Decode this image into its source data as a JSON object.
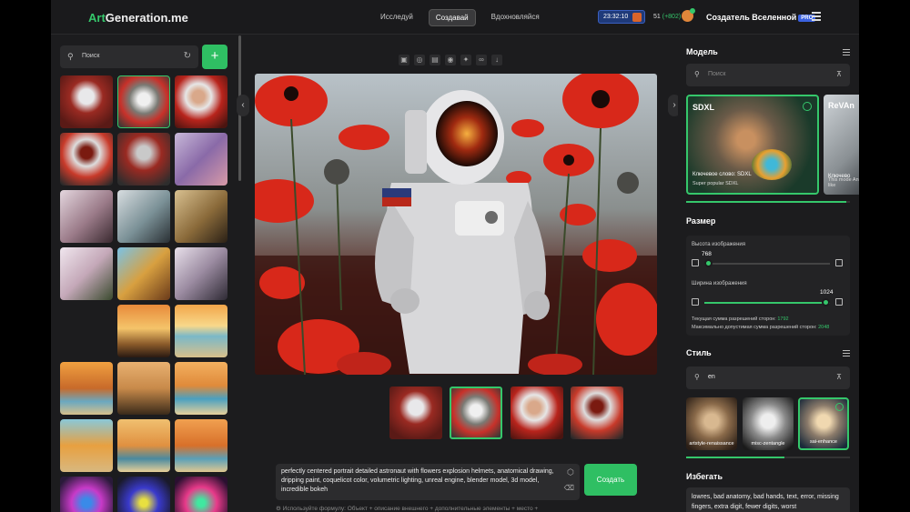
{
  "header": {
    "logo_left": "Art",
    "logo_mid": "Generation",
    "logo_right": ".me",
    "nav": [
      "Исследуй",
      "Создавай",
      "Вдохновляйся"
    ],
    "timer": "23:32:10",
    "credits": "51",
    "credits_bonus": "(+802)",
    "user_name": "Создатель Вселенной",
    "badge": "PRO"
  },
  "left": {
    "search_placeholder": "Поиск",
    "add_label": "+"
  },
  "center": {
    "prompt_text": "perfectly centered portrait detailed astronaut with flowers explosion helmets, anatomical drawing, dripping paint, coquelicot color, volumetric lighting, unreal engine, blender model, 3d model, incredible bokeh",
    "create_label": "Создать",
    "hint": "Используйте формулу: Объект + описание внешнего + дополнительные элементы + место +"
  },
  "right": {
    "model_title": "Модель",
    "model_search_placeholder": "Поиск",
    "models": [
      {
        "name": "SDXL",
        "keyword": "Ключевое слово: SDXL",
        "desc": "Super popular SDXL"
      },
      {
        "name": "ReVAn",
        "keyword": "Ключево",
        "desc": "This mode Anime-like"
      }
    ],
    "size_title": "Размер",
    "height_label": "Высота изображения",
    "height_value": "768",
    "width_label": "Ширина изображения",
    "width_value": "1024",
    "sum_label": "Текущая сумма разрешений сторон:",
    "sum_value": "1792",
    "max_label": "Максимально допустимая сумма разрешений сторон:",
    "max_value": "2048",
    "height_fraction": 0.0,
    "width_fraction": 1.0,
    "style_title": "Стиль",
    "style_search": "en",
    "styles": [
      "artstyle-renaissance",
      "misc-zentangle",
      "sai-enhance"
    ],
    "avoid_title": "Избегать",
    "avoid_text": "lowres, bad anatomy, bad hands, text, error, missing fingers, extra digit, fewer digits, worst"
  },
  "colors": {
    "accent": "#35c76b",
    "bg": "#1c1c1e",
    "panel": "#2c2c2e",
    "timer_bg": "#1f3a7a",
    "pro_badge": "#3b62e0"
  }
}
